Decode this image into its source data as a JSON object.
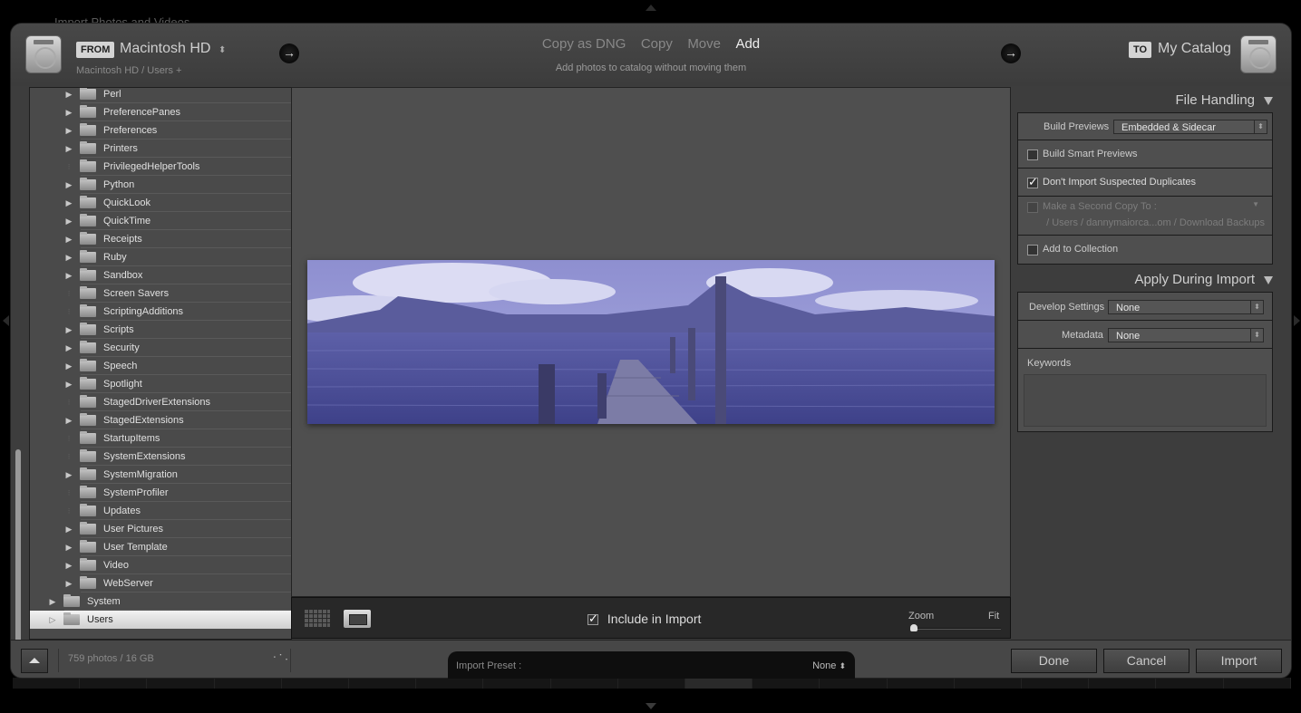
{
  "window": {
    "title": "Import Photos and Videos"
  },
  "header": {
    "from_tag": "FROM",
    "source_name": "Macintosh HD",
    "source_path": "Macintosh HD / Users +",
    "modes": [
      "Copy as DNG",
      "Copy",
      "Move",
      "Add"
    ],
    "active_mode": "Add",
    "mode_description": "Add photos to catalog without moving them",
    "to_tag": "TO",
    "destination_name": "My Catalog"
  },
  "folder_tree": {
    "items": [
      {
        "label": "Perl",
        "expandable": true
      },
      {
        "label": "PreferencePanes",
        "expandable": true
      },
      {
        "label": "Preferences",
        "expandable": true
      },
      {
        "label": "Printers",
        "expandable": true
      },
      {
        "label": "PrivilegedHelperTools",
        "expandable": false
      },
      {
        "label": "Python",
        "expandable": true
      },
      {
        "label": "QuickLook",
        "expandable": true
      },
      {
        "label": "QuickTime",
        "expandable": true
      },
      {
        "label": "Receipts",
        "expandable": true
      },
      {
        "label": "Ruby",
        "expandable": true
      },
      {
        "label": "Sandbox",
        "expandable": true
      },
      {
        "label": "Screen Savers",
        "expandable": false
      },
      {
        "label": "ScriptingAdditions",
        "expandable": false
      },
      {
        "label": "Scripts",
        "expandable": true
      },
      {
        "label": "Security",
        "expandable": true
      },
      {
        "label": "Speech",
        "expandable": true
      },
      {
        "label": "Spotlight",
        "expandable": true
      },
      {
        "label": "StagedDriverExtensions",
        "expandable": false
      },
      {
        "label": "StagedExtensions",
        "expandable": true
      },
      {
        "label": "StartupItems",
        "expandable": false
      },
      {
        "label": "SystemExtensions",
        "expandable": false
      },
      {
        "label": "SystemMigration",
        "expandable": true
      },
      {
        "label": "SystemProfiler",
        "expandable": false
      },
      {
        "label": "Updates",
        "expandable": false
      },
      {
        "label": "User Pictures",
        "expandable": true
      },
      {
        "label": "User Template",
        "expandable": true
      },
      {
        "label": "Video",
        "expandable": true
      },
      {
        "label": "WebServer",
        "expandable": true
      }
    ],
    "top_level": [
      {
        "label": "System",
        "expandable": true,
        "selected": false
      },
      {
        "label": "Users",
        "expandable": true,
        "selected": true
      }
    ]
  },
  "preview": {
    "photo_description": "Panorama of lake with wooden pier and volcano under clouds (blue tinted)",
    "include_in_import_label": "Include in Import",
    "include_in_import_checked": true,
    "zoom_label": "Zoom",
    "fit_label": "Fit",
    "zoom_level": 0
  },
  "file_handling": {
    "title": "File Handling",
    "build_previews_label": "Build Previews",
    "build_previews_value": "Embedded & Sidecar",
    "build_smart_previews_label": "Build Smart Previews",
    "build_smart_previews_checked": false,
    "dont_import_duplicates_label": "Don't Import Suspected Duplicates",
    "dont_import_duplicates_checked": true,
    "second_copy_label": "Make a Second Copy To :",
    "second_copy_checked": false,
    "second_copy_path": "/ Users / dannymaiorca...om / Download Backups",
    "add_to_collection_label": "Add to Collection",
    "add_to_collection_checked": false
  },
  "apply_during_import": {
    "title": "Apply During Import",
    "develop_settings_label": "Develop Settings",
    "develop_settings_value": "None",
    "metadata_label": "Metadata",
    "metadata_value": "None",
    "keywords_label": "Keywords",
    "keywords_value": ""
  },
  "footer": {
    "photo_count": "759 photos / 16 GB",
    "import_preset_label": "Import Preset :",
    "import_preset_value": "None",
    "done_label": "Done",
    "cancel_label": "Cancel",
    "import_label": "Import"
  }
}
